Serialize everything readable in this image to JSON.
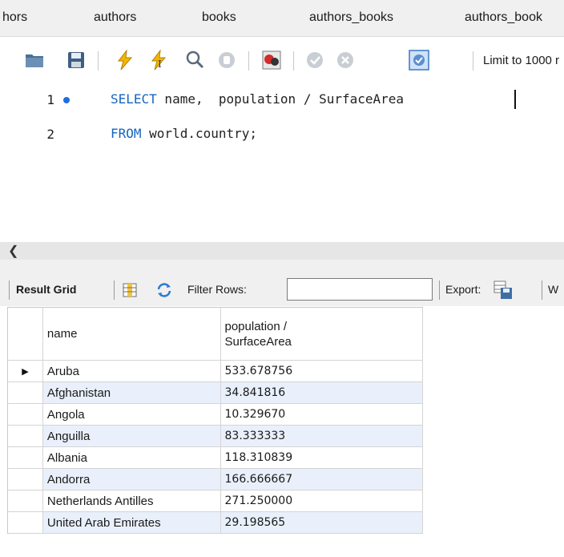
{
  "tabs": [
    "hors",
    "authors",
    "books",
    "authors_books",
    "authors_book"
  ],
  "toolbar": {
    "limit_label": "Limit to 1000 r",
    "icons": [
      "folder-icon",
      "save-icon",
      "execute-icon",
      "execute-current-icon",
      "explain-icon",
      "stop-icon",
      "toggle-error-icon",
      "commit-icon",
      "rollback-icon",
      "autocommit-icon"
    ]
  },
  "editor": {
    "lines": [
      {
        "num": "1",
        "keyword": "SELECT",
        "rest": " name,  population / SurfaceArea"
      },
      {
        "num": "2",
        "keyword": "FROM",
        "rest": " world.country;"
      }
    ]
  },
  "result_toolbar": {
    "result_grid": "Result Grid",
    "filter_rows": "Filter Rows:",
    "filter_value": "",
    "export": "Export:",
    "wrap": "W"
  },
  "grid": {
    "columns": [
      "name",
      "population /\nSurfaceArea"
    ],
    "rows": [
      {
        "name": "Aruba",
        "value": "533.678756"
      },
      {
        "name": "Afghanistan",
        "value": "34.841816"
      },
      {
        "name": "Angola",
        "value": "10.329670"
      },
      {
        "name": "Anguilla",
        "value": "83.333333"
      },
      {
        "name": "Albania",
        "value": "118.310839"
      },
      {
        "name": "Andorra",
        "value": "166.666667"
      },
      {
        "name": "Netherlands Antilles",
        "value": "271.250000"
      },
      {
        "name": "United Arab Emirates",
        "value": "29.198565"
      }
    ]
  },
  "colors": {
    "keyword": "#1565c0",
    "alt_row": "#e9f0fb",
    "breakpoint_dot": "#1e6fd9"
  }
}
